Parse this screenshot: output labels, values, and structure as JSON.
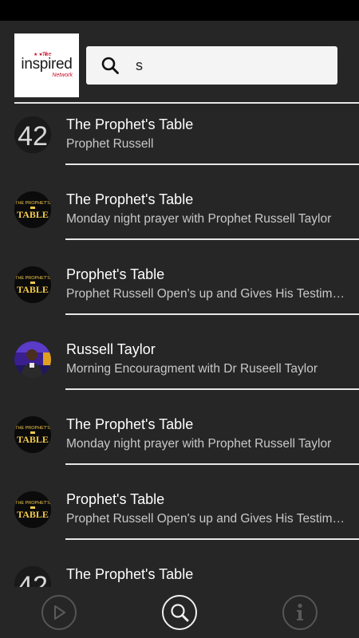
{
  "logo": {
    "the": "The",
    "main": "inspired",
    "sub": "Network"
  },
  "search": {
    "value": "s",
    "placeholder": ""
  },
  "results": [
    {
      "thumb": "42",
      "title": "The Prophet's Table",
      "subtitle": "Prophet Russell"
    },
    {
      "thumb": "table",
      "title": "The Prophet's Table",
      "subtitle": "Monday night prayer with Prophet Russell Taylor"
    },
    {
      "thumb": "table",
      "title": "Prophet's Table",
      "subtitle": "Prophet Russell Open's up and Gives His Testimony"
    },
    {
      "thumb": "portrait",
      "title": "Russell Taylor",
      "subtitle": "Morning Encouragment with Dr Ruseell Taylor"
    },
    {
      "thumb": "table",
      "title": "The Prophet's Table",
      "subtitle": "Monday night prayer with Prophet Russell Taylor"
    },
    {
      "thumb": "table",
      "title": "Prophet's Table",
      "subtitle": "Prophet Russell Open's up and Gives His Testimony"
    },
    {
      "thumb": "42",
      "title": "The Prophet's Table",
      "subtitle": ""
    }
  ],
  "thumb_text": {
    "number": "42",
    "table_top": "THE PROPHET'S",
    "table_main": "TABLE"
  },
  "nav": {
    "icons": [
      "play-icon",
      "search-icon",
      "info-icon"
    ],
    "active": "search"
  },
  "colors": {
    "background": "#262626",
    "divider": "#e6e6e6",
    "accent_gold": "#f2c94c",
    "logo_red": "#c8102e"
  }
}
